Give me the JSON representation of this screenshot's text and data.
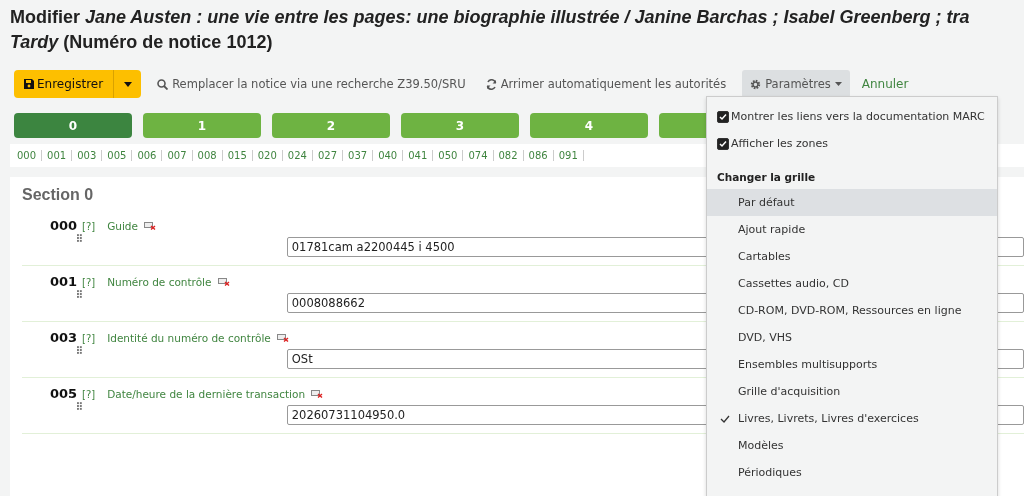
{
  "heading": {
    "line1": "Modifier *Jane Austen : une vie entre les pages: une biographie illustrée / Janine Barchas ; Isabel Greenberg ; tra*",
    "line2": "*Tardy* (Numéro de notice 1012)"
  },
  "toolbar": {
    "save": "Enregistrer",
    "replace": "Remplacer la notice via une recherche Z39.50/SRU",
    "link_authorities": "Arrimer automatiquement les autorités",
    "settings": "Paramètres",
    "cancel": "Annuler"
  },
  "tabs": [
    {
      "label": "0",
      "selected": true
    },
    {
      "label": "1",
      "selected": false
    },
    {
      "label": "2",
      "selected": false
    },
    {
      "label": "3",
      "selected": false
    },
    {
      "label": "4",
      "selected": false
    }
  ],
  "tag_links": [
    "000",
    "001",
    "003",
    "005",
    "006",
    "007",
    "008",
    "015",
    "020",
    "024",
    "027",
    "037",
    "040",
    "041",
    "050",
    "074",
    "082",
    "086",
    "091"
  ],
  "section": {
    "title": "Section 0",
    "fields": [
      {
        "tag": "000",
        "help": "[?]",
        "label": "Guide",
        "value": "01781cam a2200445 i 4500"
      },
      {
        "tag": "001",
        "help": "[?]",
        "label": "Numéro de contrôle",
        "value": "0008088662"
      },
      {
        "tag": "003",
        "help": "[?]",
        "label": "Identité du numéro de contrôle",
        "value": "OSt"
      },
      {
        "tag": "005",
        "help": "[?]",
        "label": "Date/heure de la dernière transaction",
        "value": "20260731104950.0"
      }
    ]
  },
  "settings_menu": {
    "options": [
      {
        "label": "Montrer les liens vers la documentation MARC",
        "checked": true
      },
      {
        "label": "Afficher les zones",
        "checked": true
      }
    ],
    "header": "Changer la grille",
    "frameworks": [
      {
        "label": "Par défaut",
        "selected": false,
        "hovered": true
      },
      {
        "label": "Ajout rapide",
        "selected": false,
        "hovered": false
      },
      {
        "label": "Cartables",
        "selected": false,
        "hovered": false
      },
      {
        "label": "Cassettes audio, CD",
        "selected": false,
        "hovered": false
      },
      {
        "label": "CD-ROM, DVD-ROM, Ressources en ligne",
        "selected": false,
        "hovered": false
      },
      {
        "label": "DVD, VHS",
        "selected": false,
        "hovered": false
      },
      {
        "label": "Ensembles multisupports",
        "selected": false,
        "hovered": false
      },
      {
        "label": "Grille d'acquisition",
        "selected": false,
        "hovered": false
      },
      {
        "label": "Livres, Livrets, Livres d'exercices",
        "selected": true,
        "hovered": false
      },
      {
        "label": "Modèles",
        "selected": false,
        "hovered": false
      },
      {
        "label": "Périodiques",
        "selected": false,
        "hovered": false
      }
    ]
  }
}
